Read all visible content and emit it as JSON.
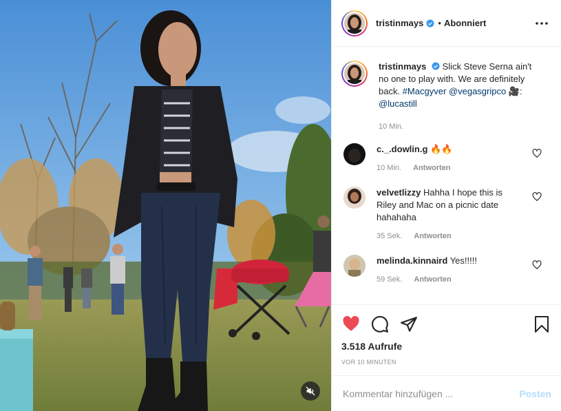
{
  "header": {
    "username": "tristinmays",
    "follow_state": "Abonniert",
    "dot": "•"
  },
  "caption": {
    "username": "tristinmays",
    "text": "Slick Steve Serna ain't no one to play with. We are definitely back.",
    "hashtag": "#Macgyver",
    "mention1": "@vegasgripco",
    "camera_emoji": "🎥",
    "colon": ":",
    "mention2": "@lucastill",
    "time": "10 Min."
  },
  "comments": [
    {
      "username": "c._.dowlin.g",
      "text": "🔥🔥",
      "time": "10 Min.",
      "reply": "Antworten"
    },
    {
      "username": "velvetlizzy",
      "text": "Hahha I hope this is Riley and Mac on a picnic date hahahaha",
      "time": "35 Sek.",
      "reply": "Antworten"
    },
    {
      "username": "melinda.kinnaird",
      "text": "Yes!!!!!",
      "time": "59 Sek.",
      "reply": "Antworten"
    }
  ],
  "stats": {
    "views": "3.518 Aufrufe",
    "posted_ago": "VOR 10 MINUTEN"
  },
  "composer": {
    "placeholder": "Kommentar hinzufügen ...",
    "post_label": "Posten"
  },
  "icons": {
    "verified": "verified-badge-icon",
    "more": "more-options-icon",
    "like": "heart-filled-icon",
    "comment": "comment-bubble-icon",
    "share": "paper-plane-icon",
    "save": "bookmark-icon",
    "mute": "speaker-muted-icon"
  },
  "colors": {
    "like_red": "#ed4956",
    "verified_blue": "#3897f0",
    "link_blue": "#00376b",
    "post_button_disabled": "#b2dffc"
  }
}
